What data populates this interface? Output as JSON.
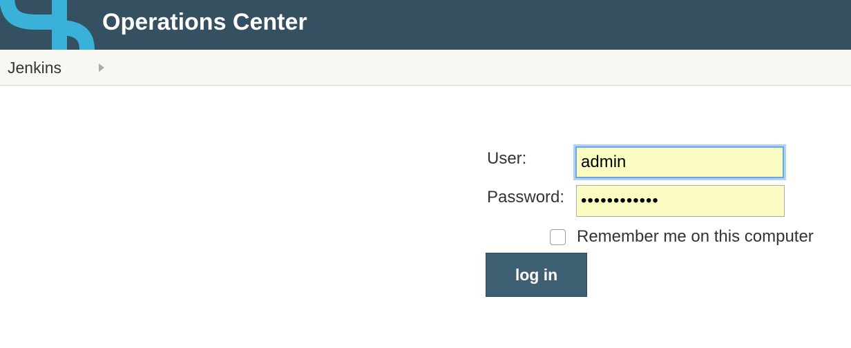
{
  "header": {
    "title": "Operations Center",
    "logo_icon": "cloudbees-logo-icon",
    "background": "#355060",
    "logo_color": "#3ab1d8"
  },
  "breadcrumb": {
    "items": [
      {
        "label": "Jenkins"
      }
    ],
    "separator_icon": "chevron-right-icon"
  },
  "login": {
    "user_label": "User:",
    "user_value": "admin",
    "password_label": "Password:",
    "password_value": "••••••••••••",
    "remember_label": "Remember me on this computer",
    "remember_checked": false,
    "submit_label": "log in",
    "field_bg": "#fbfcc2",
    "button_color": "#3f5f72"
  }
}
